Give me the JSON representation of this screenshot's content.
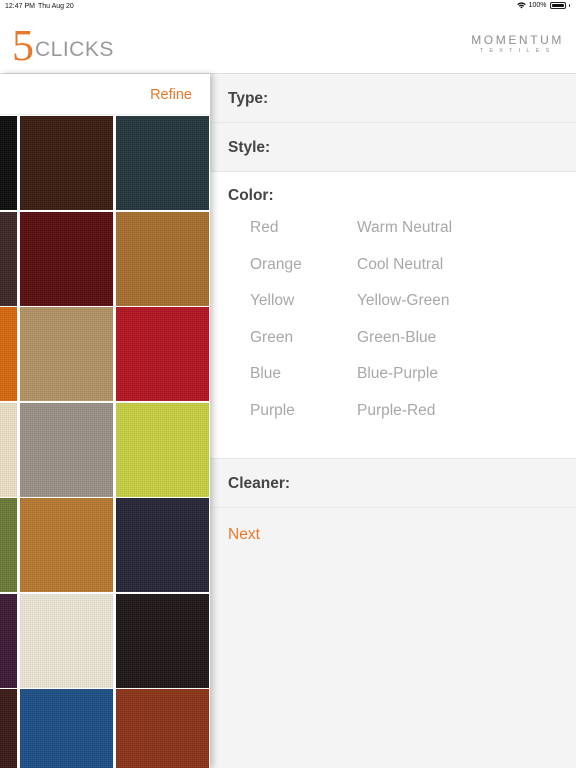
{
  "status": {
    "time": "12:47 PM",
    "date": "Thu Aug 20",
    "battery": "100%"
  },
  "header": {
    "brand_number": "5",
    "brand_word": "CLICKS",
    "partner_name": "MOMENTUM",
    "partner_tagline": "TEXTILES"
  },
  "left": {
    "refine_label": "Refine",
    "swatches": [
      [
        "#0c0c0c",
        "#3a1c10",
        "#23373d"
      ],
      [
        "#3c2826",
        "#5a0d0e",
        "#a8702f"
      ],
      [
        "#d96a12",
        "#b49566",
        "#b51522"
      ],
      [
        "#eee3c8",
        "#9c9288",
        "#c9d142"
      ],
      [
        "#6c7b38",
        "#b87930",
        "#262535"
      ],
      [
        "#3b1a34",
        "#ede8d8",
        "#1e1716"
      ],
      [
        "#3a1a17",
        "#1d4f86",
        "#8c3418"
      ]
    ]
  },
  "refine": {
    "type_label": "Type:",
    "style_label": "Style:",
    "color_label": "Color:",
    "colors_col1": [
      "Red",
      "Orange",
      "Yellow",
      "Green",
      "Blue",
      "Purple"
    ],
    "colors_col2": [
      "Warm Neutral",
      "Cool Neutral",
      "Yellow-Green",
      "Green-Blue",
      "Blue-Purple",
      "Purple-Red"
    ],
    "cleaner_label": "Cleaner:",
    "next_label": "Next"
  },
  "colors": {
    "accent": "#e8782a",
    "option_text": "#a8a8a8",
    "label_text": "#444444"
  }
}
